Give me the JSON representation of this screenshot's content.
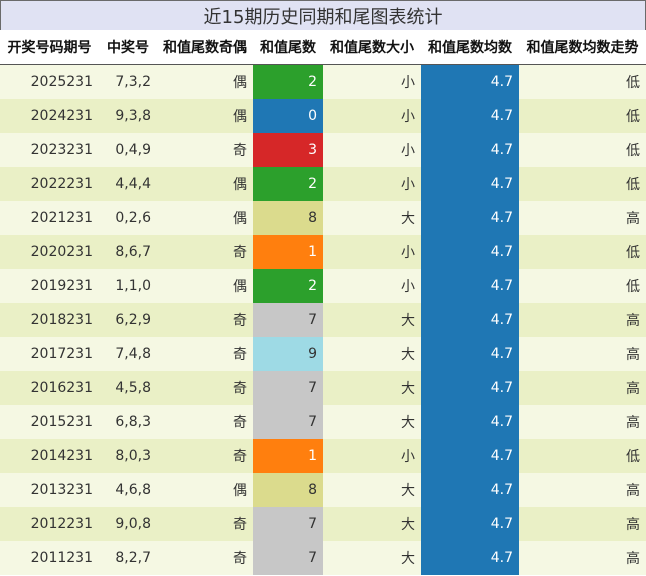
{
  "title": "近15期历史同期和尾图表统计",
  "headers": [
    "开奖号码期号",
    "中奖号",
    "和值尾数奇偶",
    "和值尾数",
    "和值尾数大小",
    "和值尾数均数",
    "和值尾数均数走势"
  ],
  "colors": {
    "title_bg": "#e0e2f3",
    "row_odd": "#f5f8e3",
    "row_even": "#eaf0c6",
    "average": "#1f77b4",
    "tail_0": "#1f77b4",
    "tail_1": "#ff7f0e",
    "tail_2": "#2ca02c",
    "tail_3": "#d62728",
    "tail_7": "#c7c7c7",
    "tail_8": "#dbdb8d",
    "tail_9": "#9edae5"
  },
  "rows": [
    {
      "issue": "2025231",
      "numbers": "7,3,2",
      "parity": "偶",
      "tail": "2",
      "size": "小",
      "avg": "4.7",
      "trend": "低"
    },
    {
      "issue": "2024231",
      "numbers": "9,3,8",
      "parity": "偶",
      "tail": "0",
      "size": "小",
      "avg": "4.7",
      "trend": "低"
    },
    {
      "issue": "2023231",
      "numbers": "0,4,9",
      "parity": "奇",
      "tail": "3",
      "size": "小",
      "avg": "4.7",
      "trend": "低"
    },
    {
      "issue": "2022231",
      "numbers": "4,4,4",
      "parity": "偶",
      "tail": "2",
      "size": "小",
      "avg": "4.7",
      "trend": "低"
    },
    {
      "issue": "2021231",
      "numbers": "0,2,6",
      "parity": "偶",
      "tail": "8",
      "size": "大",
      "avg": "4.7",
      "trend": "高"
    },
    {
      "issue": "2020231",
      "numbers": "8,6,7",
      "parity": "奇",
      "tail": "1",
      "size": "小",
      "avg": "4.7",
      "trend": "低"
    },
    {
      "issue": "2019231",
      "numbers": "1,1,0",
      "parity": "偶",
      "tail": "2",
      "size": "小",
      "avg": "4.7",
      "trend": "低"
    },
    {
      "issue": "2018231",
      "numbers": "6,2,9",
      "parity": "奇",
      "tail": "7",
      "size": "大",
      "avg": "4.7",
      "trend": "高"
    },
    {
      "issue": "2017231",
      "numbers": "7,4,8",
      "parity": "奇",
      "tail": "9",
      "size": "大",
      "avg": "4.7",
      "trend": "高"
    },
    {
      "issue": "2016231",
      "numbers": "4,5,8",
      "parity": "奇",
      "tail": "7",
      "size": "大",
      "avg": "4.7",
      "trend": "高"
    },
    {
      "issue": "2015231",
      "numbers": "6,8,3",
      "parity": "奇",
      "tail": "7",
      "size": "大",
      "avg": "4.7",
      "trend": "高"
    },
    {
      "issue": "2014231",
      "numbers": "8,0,3",
      "parity": "奇",
      "tail": "1",
      "size": "小",
      "avg": "4.7",
      "trend": "低"
    },
    {
      "issue": "2013231",
      "numbers": "4,6,8",
      "parity": "偶",
      "tail": "8",
      "size": "大",
      "avg": "4.7",
      "trend": "高"
    },
    {
      "issue": "2012231",
      "numbers": "9,0,8",
      "parity": "奇",
      "tail": "7",
      "size": "大",
      "avg": "4.7",
      "trend": "高"
    },
    {
      "issue": "2011231",
      "numbers": "8,2,7",
      "parity": "奇",
      "tail": "7",
      "size": "大",
      "avg": "4.7",
      "trend": "高"
    }
  ]
}
